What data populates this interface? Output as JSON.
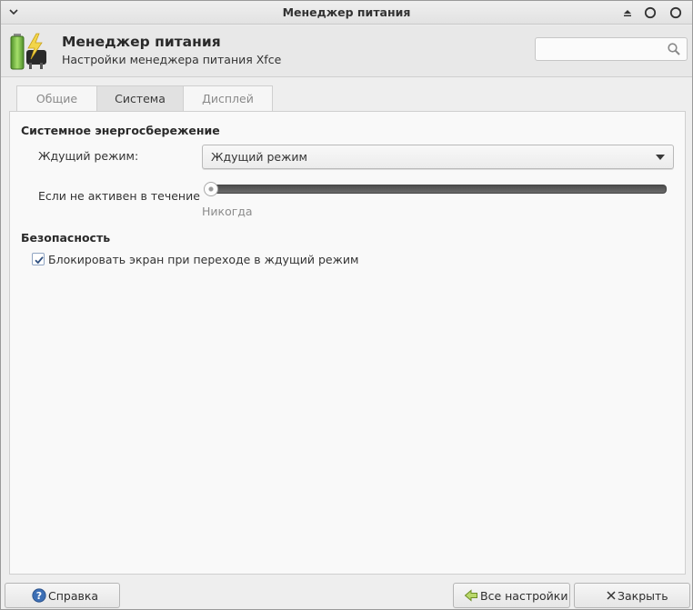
{
  "window": {
    "title": "Менеджер питания"
  },
  "header": {
    "title": "Менеджер питания",
    "subtitle": "Настройки менеджера питания Xfce",
    "search_placeholder": ""
  },
  "tabs": [
    {
      "label": "Общие",
      "active": false
    },
    {
      "label": "Система",
      "active": true
    },
    {
      "label": "Дисплей",
      "active": false
    }
  ],
  "system_page": {
    "power_saving": {
      "section_title": "Системное энергосбережение",
      "sleep_mode_label": "Ждущий режим:",
      "sleep_mode_value": "Ждущий режим",
      "inactive_label": "Если не активен в течение",
      "inactive_value_text": "Никогда",
      "inactive_slider_fraction": 0
    },
    "security": {
      "section_title": "Безопасность",
      "lock_screen_label": "Блокировать экран при переходе в ждущий режим",
      "lock_screen_checked": true
    }
  },
  "footer": {
    "help_label": "Справка",
    "all_settings_label": "Все настройки",
    "close_label": "Закрыть"
  },
  "icons": {
    "window_menu": "chevron-down-icon",
    "shade": "shade-icon",
    "maximize": "maximize-icon",
    "close": "close-icon",
    "app": "battery-power-icon",
    "search": "search-icon",
    "help": "help-icon",
    "all_settings": "back-arrow-icon",
    "close_button": "x-icon"
  }
}
